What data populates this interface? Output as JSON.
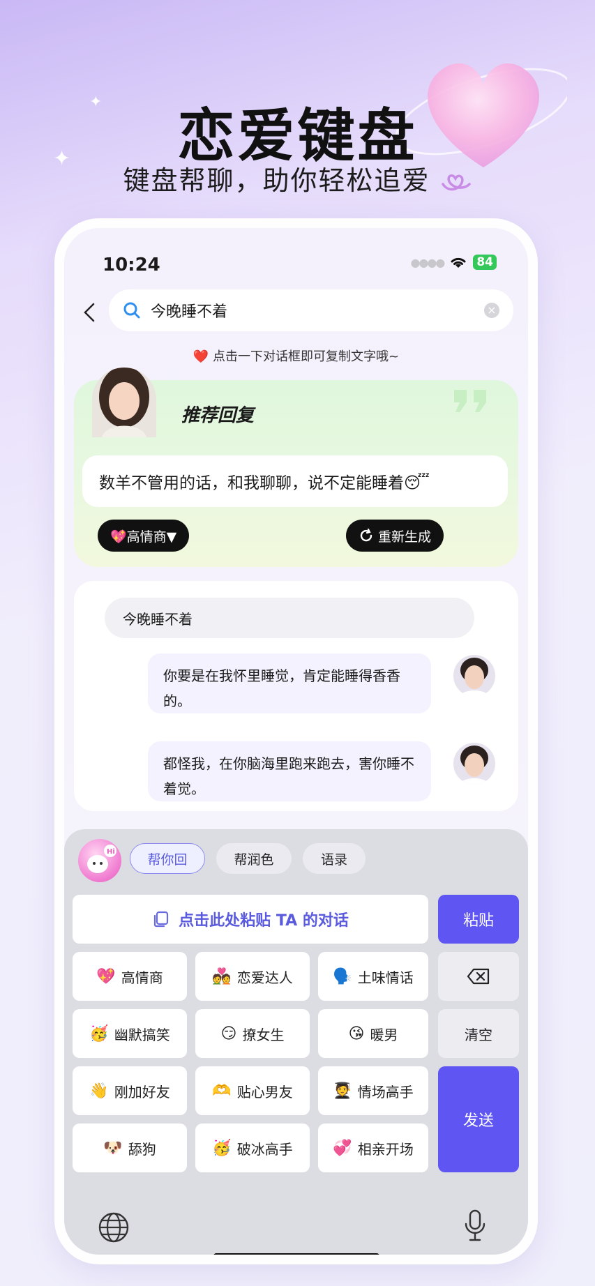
{
  "hero": {
    "title": "恋爱键盘",
    "subtitle": "键盘帮聊，助你轻松追爱"
  },
  "status": {
    "time": "10:24",
    "battery": "84"
  },
  "search": {
    "query": "今晚睡不着"
  },
  "tip": "❤️ 点击一下对话框即可复制文字哦~",
  "recommend": {
    "title": "推荐回复",
    "text": "数羊不管用的话，和我聊聊，说不定能睡着😴",
    "style_label": "💖高情商▼",
    "regen_label": "重新生成"
  },
  "chat": {
    "their_message": "今晚睡不着",
    "replies": [
      "你要是在我怀里睡觉，肯定能睡得香香的。",
      "都怪我，在你脑海里跑来跑去，害你睡不着觉。"
    ]
  },
  "keyboard": {
    "tabs": [
      "帮你回",
      "帮润色",
      "语录"
    ],
    "paste_prompt": "点击此处粘贴 TA 的对话",
    "paste_label": "粘贴",
    "clear_label": "清空",
    "send_label": "发送",
    "keys": [
      {
        "emoji": "💖",
        "label": "高情商"
      },
      {
        "emoji": "💑",
        "label": "恋爱达人"
      },
      {
        "emoji": "🗣️",
        "label": "土味情话"
      },
      {
        "emoji": "🥳",
        "label": "幽默搞笑"
      },
      {
        "emoji": "😏",
        "label": "撩女生"
      },
      {
        "emoji": "😘",
        "label": "暖男"
      },
      {
        "emoji": "👋",
        "label": "刚加好友"
      },
      {
        "emoji": "🫶",
        "label": "贴心男友"
      },
      {
        "emoji": "🧑‍🎓",
        "label": "情场高手"
      },
      {
        "emoji": "🐶",
        "label": "舔狗"
      },
      {
        "emoji": "🥳",
        "label": "破冰高手"
      },
      {
        "emoji": "💞",
        "label": "相亲开场"
      }
    ]
  },
  "colors": {
    "accent": "#5e55f2",
    "bubble_mine": "#f4f2fe",
    "rec_card": "#dff7dd"
  }
}
